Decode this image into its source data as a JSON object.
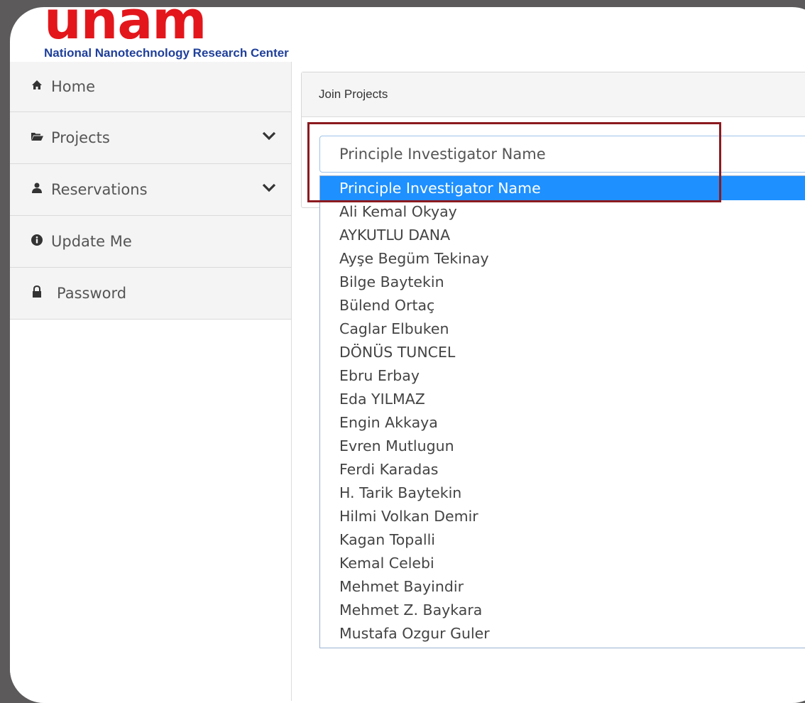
{
  "header": {
    "logo": "unam",
    "subtitle": "National Nanotechnology Research Center"
  },
  "sidebar": {
    "items": [
      {
        "label": "Home",
        "icon": "home-icon",
        "has_chevron": false
      },
      {
        "label": "Projects",
        "icon": "folder-open-icon",
        "has_chevron": true
      },
      {
        "label": "Reservations",
        "icon": "user-icon",
        "has_chevron": true
      },
      {
        "label": "Update Me",
        "icon": "info-circle-icon",
        "has_chevron": false
      },
      {
        "label": "Password",
        "icon": "lock-icon",
        "has_chevron": false
      }
    ]
  },
  "panel": {
    "title": "Join Projects",
    "select": {
      "value": "Principle Investigator Name",
      "options": [
        "Principle Investigator Name",
        "Ali Kemal Okyay",
        "AYKUTLU DANA",
        "Ayşe Begüm Tekinay",
        "Bilge Baytekin",
        "Bülend Ortaç",
        "Caglar Elbuken",
        "DÖNÜS TUNCEL",
        "Ebru Erbay",
        "Eda YILMAZ",
        "Engin Akkaya",
        "Evren Mutlugun",
        "Ferdi Karadas",
        "H. Tarik Baytekin",
        "Hilmi Volkan Demir",
        "Kagan Topalli",
        "Kemal Celebi",
        "Mehmet Bayindir",
        "Mehmet Z. Baykara",
        "Mustafa Ozgur Guler"
      ],
      "selected_index": 0
    }
  },
  "colors": {
    "logo": "#e3161b",
    "subtitle": "#1f3f9a",
    "selected_option": "#1e90ff",
    "highlight_border": "#8b1a1f"
  }
}
